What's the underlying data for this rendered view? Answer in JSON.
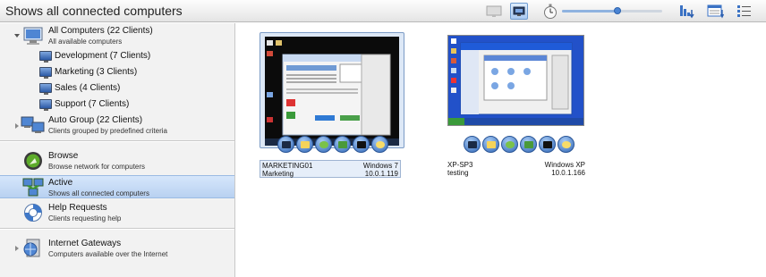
{
  "header": {
    "title": "Shows all connected computers",
    "toolbar": {
      "icons": [
        "screen-off-icon",
        "screen-view-icon",
        "stopwatch-icon",
        "sort-icon",
        "detail-view-icon",
        "list-view-icon"
      ],
      "zoom_slider_level": 0.55
    }
  },
  "sidebar": {
    "groups": [
      {
        "title": "All Computers (22 Clients)",
        "subtitle": "All available computers",
        "expanded": true
      },
      {
        "title": "Auto Group (22 Clients)",
        "subtitle": "Clients grouped by predefined criteria",
        "expanded": false
      }
    ],
    "subgroups": [
      {
        "label": "Development (7 Clients)"
      },
      {
        "label": "Marketing (3 Clients)"
      },
      {
        "label": "Sales (4 Clients)"
      },
      {
        "label": "Support (7 Clients)"
      }
    ],
    "views": [
      {
        "title": "Browse",
        "subtitle": "Browse network for computers"
      },
      {
        "title": "Active",
        "subtitle": "Shows all connected computers",
        "selected": true
      },
      {
        "title": "Help Requests",
        "subtitle": "Clients requesting help"
      }
    ],
    "gateways": {
      "title": "Internet Gateways",
      "subtitle": "Computers available over the Internet"
    }
  },
  "computers": [
    {
      "name": "MARKETING01",
      "os": "Windows 7",
      "group": "Marketing",
      "ip": "10.0.1.119",
      "selected": true
    },
    {
      "name": "XP-SP3",
      "os": "Windows XP",
      "group": "testing",
      "ip": "10.0.1.166",
      "selected": false
    }
  ],
  "colors": {
    "accent": "#4a84d3",
    "selection": "#c6dbf6",
    "desktop_win7": "#0b0b0b",
    "desktop_xp": "#2251c9"
  }
}
